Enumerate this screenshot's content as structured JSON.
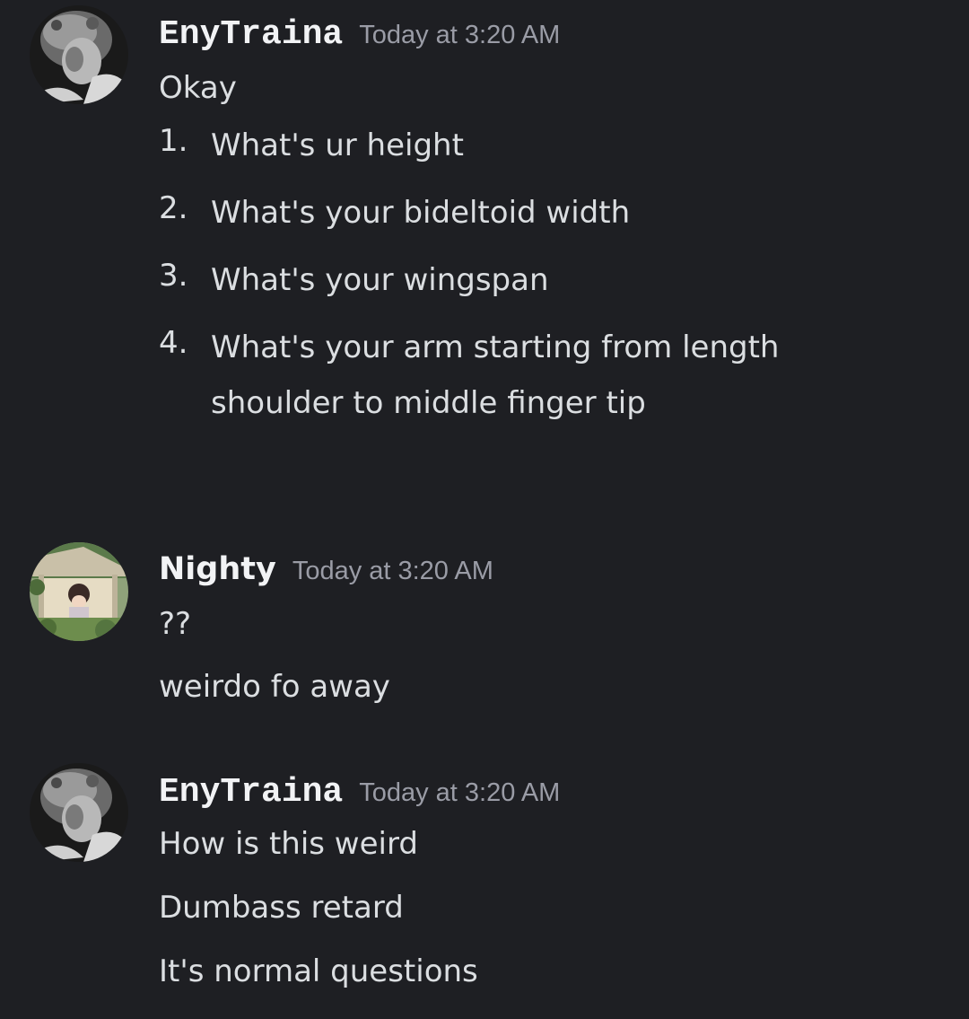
{
  "messages": [
    {
      "author": "EnyTraina",
      "timestamp": "Today at 3:20 AM",
      "lines": [
        "Okay"
      ],
      "list": [
        {
          "number": "1.",
          "text": "What's ur height"
        },
        {
          "number": "2.",
          "text": "What's your bideltoid width"
        },
        {
          "number": "3.",
          "text": "What's your wingspan"
        },
        {
          "number": "4.",
          "text": "What's your arm starting from length shoulder to middle finger tip"
        }
      ]
    },
    {
      "author": "Nighty",
      "timestamp": "Today at 3:20 AM",
      "lines": [
        "??",
        "weirdo fo away"
      ]
    },
    {
      "author": "EnyTraina",
      "timestamp": "Today at 3:20 AM",
      "lines": [
        "How is this weird",
        "Dumbass retard",
        "It's normal questions"
      ]
    }
  ]
}
